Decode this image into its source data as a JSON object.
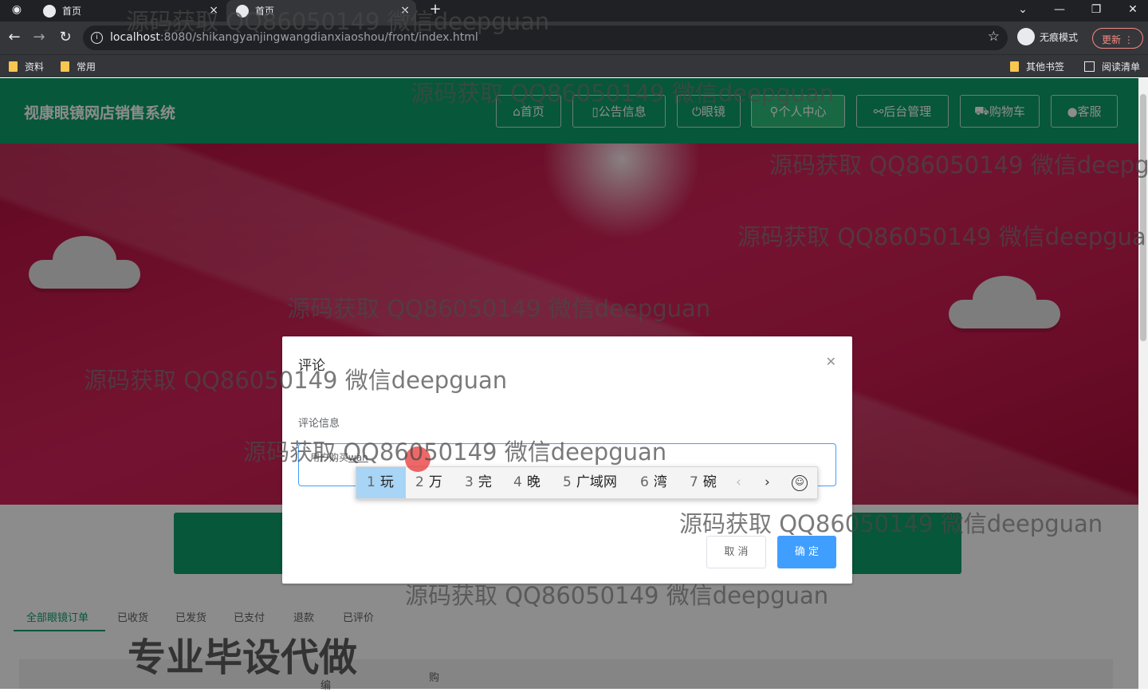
{
  "browser": {
    "tabs": [
      {
        "label": "首页",
        "active": false
      },
      {
        "label": "首页",
        "active": true
      }
    ],
    "new_tab_symbol": "+",
    "url_host": "localhost",
    "url_rest": ":8080/shikangyanjingwangdianxiaoshou/front/index.html",
    "incognito_label": "无痕模式",
    "update_label": "更新",
    "bookmarks": [
      "资料",
      "常用"
    ],
    "bookmarks_right": [
      "其他书签",
      "阅读清单"
    ]
  },
  "site": {
    "title": "视康眼镜网店销售系统",
    "nav": [
      {
        "icon": "home-icon",
        "glyph": "⌂",
        "label": "首页",
        "active": false
      },
      {
        "icon": "announcement-icon",
        "glyph": "▯",
        "label": "公告信息",
        "active": false
      },
      {
        "icon": "power-icon",
        "glyph": "⏻",
        "label": "眼镜",
        "active": false
      },
      {
        "icon": "user-icon",
        "glyph": "⚲",
        "label": "个人中心",
        "active": true
      },
      {
        "icon": "link-icon",
        "glyph": "⚯",
        "label": "后台管理",
        "active": false
      },
      {
        "icon": "cart-icon",
        "glyph": "⛟",
        "label": "购物车",
        "active": false
      },
      {
        "icon": "chat-icon",
        "glyph": "●",
        "label": "客服",
        "active": false
      }
    ]
  },
  "orders": {
    "tabs": [
      "全部眼镜订单",
      "已收货",
      "已发货",
      "已支付",
      "退款",
      "已评价"
    ],
    "active_tab": "全部眼镜订单",
    "table_headers": [
      "编",
      "购"
    ]
  },
  "dialog": {
    "title": "评论",
    "field_label": "评论信息",
    "input_value": "用户购买",
    "input_composing": "wan",
    "cancel_label": "取 消",
    "confirm_label": "确 定"
  },
  "ime": {
    "candidates": [
      {
        "num": "1",
        "text": "玩",
        "selected": true
      },
      {
        "num": "2",
        "text": "万",
        "selected": false
      },
      {
        "num": "3",
        "text": "完",
        "selected": false
      },
      {
        "num": "4",
        "text": "晚",
        "selected": false
      },
      {
        "num": "5",
        "text": "广域网",
        "selected": false
      },
      {
        "num": "6",
        "text": "湾",
        "selected": false
      },
      {
        "num": "7",
        "text": "碗",
        "selected": false
      }
    ]
  },
  "watermark": {
    "text": "源码获取 QQ86050149 微信deepguan",
    "caption": "专业毕设代做"
  },
  "colors": {
    "header_green": "#0e9e6a",
    "banner_red": "#c81b4f",
    "primary_blue": "#409eff"
  }
}
